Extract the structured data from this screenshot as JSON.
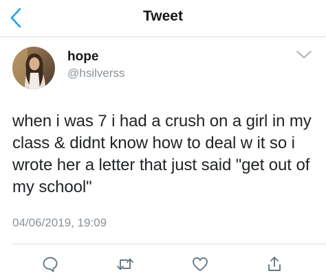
{
  "nav": {
    "title": "Tweet",
    "back_icon": "chevron-left-icon"
  },
  "author": {
    "display_name": "hope",
    "handle": "@hsilverss",
    "avatar": "avatar-photo",
    "menu_icon": "chevron-down-icon"
  },
  "tweet": {
    "text": "when i was 7 i had a crush on a girl in my class & didnt know how to deal w it so i wrote her a letter that just said \"get out of my school\"",
    "timestamp": "04/06/2019, 19:09"
  },
  "actions": [
    {
      "name": "reply",
      "icon": "reply-icon"
    },
    {
      "name": "retweet",
      "icon": "retweet-icon"
    },
    {
      "name": "like",
      "icon": "heart-icon"
    },
    {
      "name": "share",
      "icon": "share-icon"
    }
  ],
  "colors": {
    "accent": "#1da1f2",
    "text": "#14171a",
    "secondary_text": "#8a9198",
    "icon_gray": "#657786",
    "divider": "#d9dde0"
  }
}
